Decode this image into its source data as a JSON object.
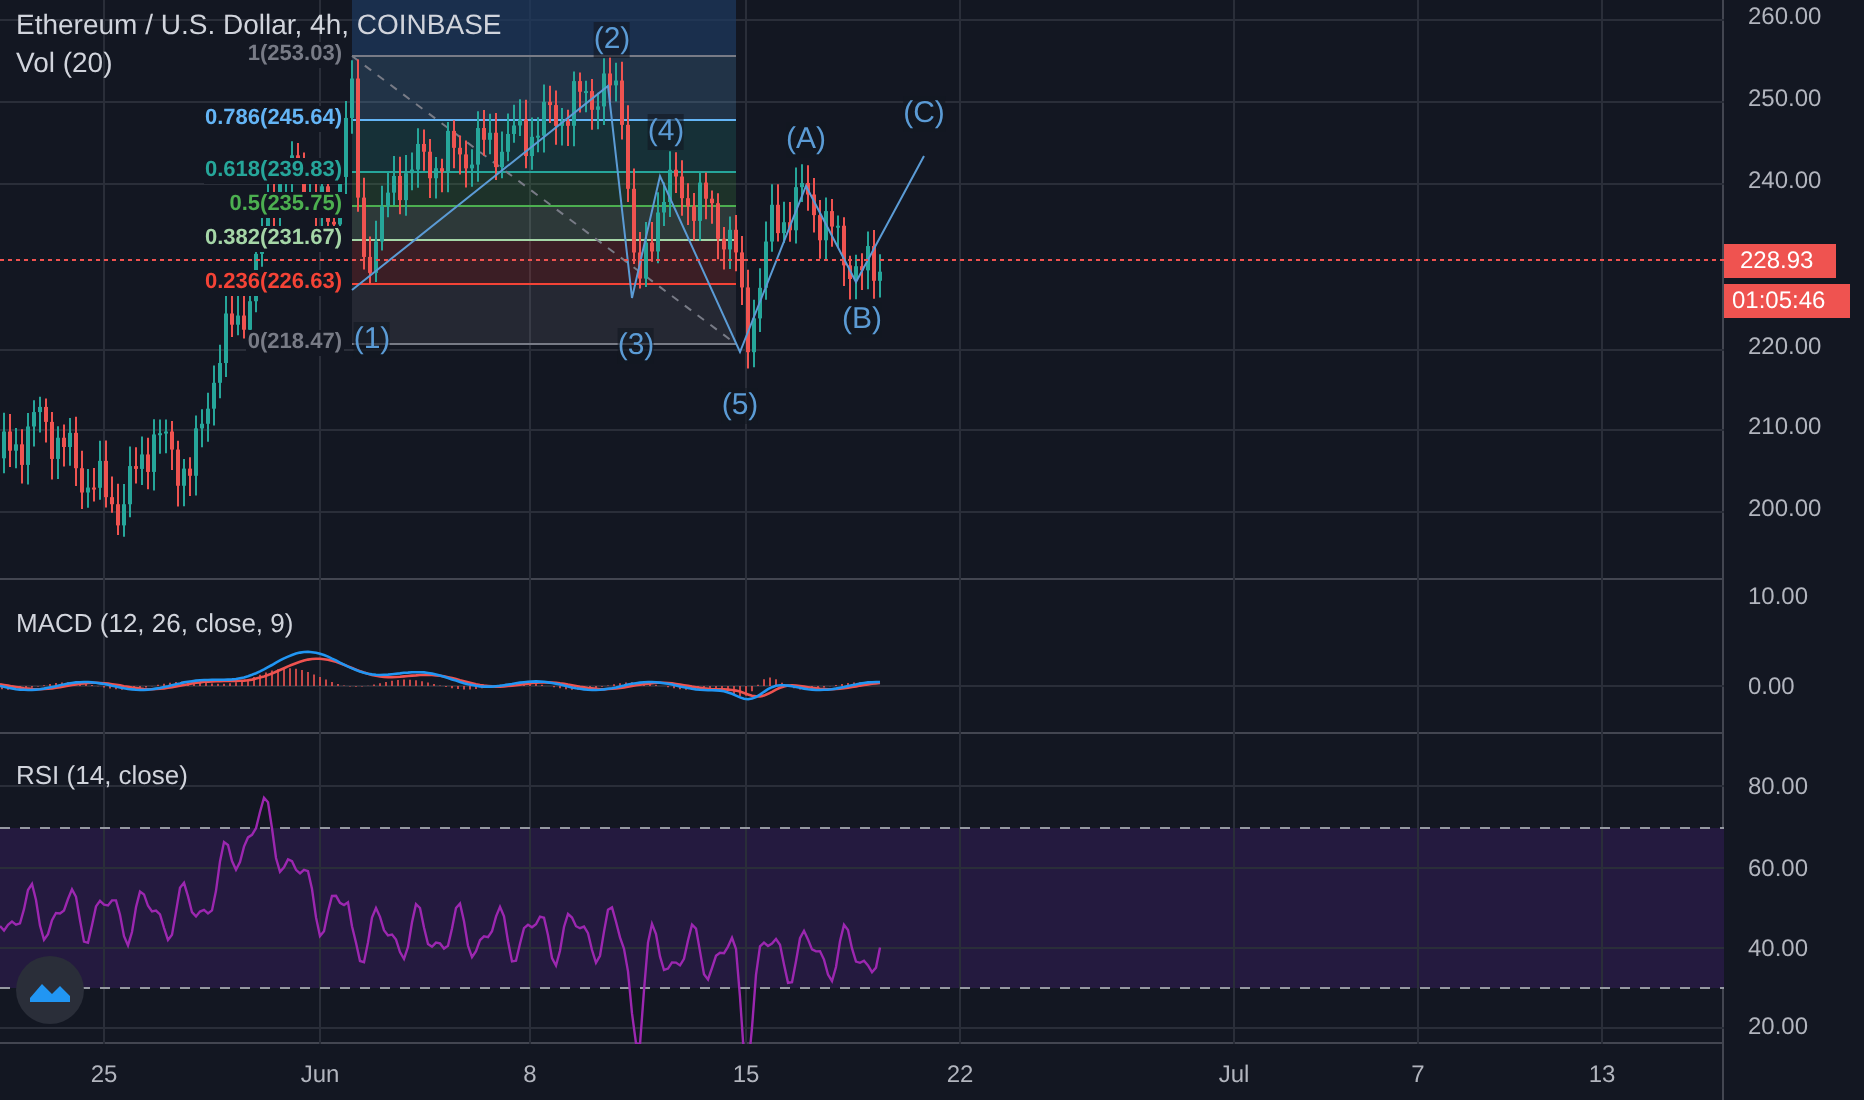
{
  "legend": {
    "title": "Ethereum / U.S. Dollar, 4h, COINBASE",
    "volume": "Vol (20)"
  },
  "fib_levels": [
    {
      "label": "1(253.03)",
      "color": "#787b86"
    },
    {
      "label": "0.786(245.64)",
      "color": "#64b5f6"
    },
    {
      "label": "0.618(239.83)",
      "color": "#26a69a"
    },
    {
      "label": "0.5(235.75)",
      "color": "#4caf50"
    },
    {
      "label": "0.382(231.67)",
      "color": "#a5d6a7"
    },
    {
      "label": "0.236(226.63)",
      "color": "#f44336"
    },
    {
      "label": "0(218.47)",
      "color": "#787b86"
    }
  ],
  "wave_labels": [
    "(1)",
    "(2)",
    "(3)",
    "(4)",
    "(5)",
    "(A)",
    "(B)",
    "(C)"
  ],
  "price_axis": [
    "260.00",
    "250.00",
    "240.00",
    "220.00",
    "210.00",
    "200.00"
  ],
  "current_price": "228.93",
  "countdown": "01:05:46",
  "macd": {
    "label": "MACD (12, 26, close, 9)",
    "axis": [
      "10.00",
      "0.00"
    ]
  },
  "rsi": {
    "label": "RSI (14, close)",
    "axis": [
      "80.00",
      "60.00",
      "40.00",
      "20.00"
    ]
  },
  "time_axis": [
    "25",
    "Jun",
    "8",
    "15",
    "22",
    "Jul",
    "7",
    "13"
  ]
}
